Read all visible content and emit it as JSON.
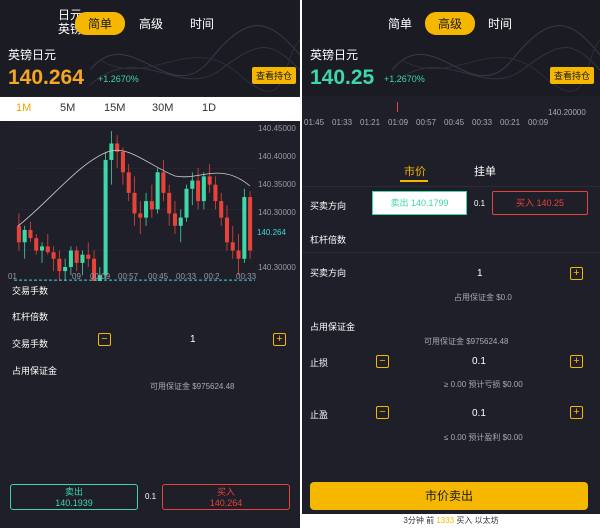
{
  "left": {
    "overlay_text_1": "日元",
    "overlay_text_2": "英镑",
    "tabs": [
      "简单",
      "高级",
      "时间"
    ],
    "active_tab": 0,
    "pair_name": "英镑日元",
    "price": "140.264",
    "change": "+1.2670%",
    "hold_button": "查看持仓",
    "timeframes": [
      "1M",
      "5M",
      "15M",
      "30M",
      "1D"
    ],
    "active_timeframe": 0,
    "y_ticks": [
      "140.45000",
      "140.40000",
      "140.35000",
      "140.30000",
      "140.264",
      "140.30000"
    ],
    "x_ticks": [
      "01",
      "09",
      "00:09",
      "00:57",
      "00:45",
      "00:33",
      "00:2",
      "00:33"
    ],
    "current_price_label": "140.264",
    "labels": {
      "trade_qty_1": "交易手数",
      "leverage": "杠杆倍数",
      "trade_qty_2": "交易手数",
      "margin": "占用保证金"
    },
    "qty_value": "1",
    "available_margin": "可用保证金 $975624.48",
    "sell_label": "卖出",
    "sell_price": "140.1939",
    "spread": "0.1",
    "buy_label": "买入",
    "buy_price": "140.264",
    "stepper_minus": "−",
    "stepper_plus": "+"
  },
  "right": {
    "tabs": [
      "简单",
      "高级",
      "时间"
    ],
    "active_tab": 1,
    "pair_name": "英镑日元",
    "price": "140.25",
    "change": "+1.2670%",
    "hold_button": "查看持仓",
    "axis_times": [
      "01:45",
      "01:33",
      "01:21",
      "01:09",
      "00:57",
      "00:45",
      "00:33",
      "00:21",
      "00:09"
    ],
    "axis_price": "140.20000",
    "order_tabs": [
      "市价",
      "挂单"
    ],
    "active_order_tab": 0,
    "direction_label": "买卖方向",
    "sell_btn": "卖出 140.1799",
    "spread": "0.1",
    "buy_btn": "买入 140.25",
    "leverage_label": "杠杆倍数",
    "direction_label_2": "买卖方向",
    "qty_value": "1",
    "margin_note_1": "占用保证金 $0.0",
    "margin_label": "占用保证金",
    "available_margin": "可用保证金 $975624.48",
    "stop_loss_label": "止损",
    "stop_loss_value": "0.1",
    "stop_loss_note": "≥ 0.00 预计亏损 $0.00",
    "take_profit_label": "止盈",
    "take_profit_value": "0.1",
    "take_profit_note": "≤ 0.00 预计盈利 $0.00",
    "submit_button": "市价卖出",
    "footer_prefix": "3分钟 前",
    "footer_highlight": "1333",
    "footer_suffix": "买入 以太坊",
    "stepper_minus": "−",
    "stepper_plus": "+"
  },
  "colors": {
    "accent": "#f5b700",
    "up": "#3fd6a8",
    "down": "#e8433b",
    "panel_bg": "#1f1f29"
  },
  "chart_data": {
    "type": "candlestick",
    "y_ticks": [
      "140.45000",
      "140.40000",
      "140.35000",
      "140.30000",
      "140.30000"
    ],
    "ylim": [
      140.28,
      140.45
    ],
    "current_price": 140.264,
    "x_ticks": [
      "01",
      "09",
      "00:09",
      "00:57",
      "00:45",
      "00:33",
      "00:2",
      "00:33"
    ],
    "series": [
      {
        "values": [
          [
            140.33,
            140.345,
            140.3,
            140.31
          ],
          [
            140.31,
            140.33,
            140.29,
            140.325
          ],
          [
            140.325,
            140.335,
            140.31,
            140.315
          ],
          [
            140.315,
            140.32,
            140.295,
            140.3
          ],
          [
            140.3,
            140.31,
            140.285,
            140.305
          ],
          [
            140.305,
            140.32,
            140.295,
            140.298
          ],
          [
            140.298,
            140.305,
            140.275,
            140.29
          ],
          [
            140.29,
            140.3,
            140.262,
            140.275
          ],
          [
            140.275,
            140.29,
            140.26,
            140.28
          ],
          [
            140.28,
            140.305,
            140.27,
            140.3
          ],
          [
            140.3,
            140.305,
            140.275,
            140.285
          ],
          [
            140.285,
            140.3,
            140.27,
            140.295
          ],
          [
            140.295,
            140.31,
            140.28,
            140.29
          ],
          [
            140.29,
            140.3,
            140.25,
            140.26
          ],
          [
            140.26,
            140.28,
            140.23,
            140.27
          ],
          [
            140.27,
            140.42,
            140.265,
            140.41
          ],
          [
            140.41,
            140.445,
            140.38,
            140.43
          ],
          [
            140.43,
            140.44,
            140.4,
            140.42
          ],
          [
            140.42,
            140.425,
            140.38,
            140.395
          ],
          [
            140.395,
            140.405,
            140.36,
            140.37
          ],
          [
            140.37,
            140.39,
            140.33,
            140.345
          ],
          [
            140.345,
            140.36,
            140.32,
            140.34
          ],
          [
            140.34,
            140.37,
            140.33,
            140.36
          ],
          [
            140.36,
            140.38,
            140.34,
            140.35
          ],
          [
            140.35,
            140.4,
            140.345,
            140.395
          ],
          [
            140.395,
            140.41,
            140.36,
            140.37
          ],
          [
            140.37,
            140.38,
            140.33,
            140.345
          ],
          [
            140.345,
            140.36,
            140.32,
            140.33
          ],
          [
            140.33,
            140.35,
            140.31,
            140.34
          ],
          [
            140.34,
            140.38,
            140.335,
            140.375
          ],
          [
            140.375,
            140.395,
            140.355,
            140.385
          ],
          [
            140.385,
            140.4,
            140.35,
            140.36
          ],
          [
            140.36,
            140.395,
            140.35,
            140.39
          ],
          [
            140.39,
            140.405,
            140.37,
            140.38
          ],
          [
            140.38,
            140.39,
            140.35,
            140.36
          ],
          [
            140.36,
            140.37,
            140.33,
            140.34
          ],
          [
            140.34,
            140.355,
            140.3,
            140.31
          ],
          [
            140.31,
            140.33,
            140.29,
            140.3
          ],
          [
            140.3,
            140.32,
            140.27,
            140.29
          ],
          [
            140.29,
            140.375,
            140.285,
            140.365
          ],
          [
            140.365,
            140.372,
            140.29,
            140.3
          ]
        ]
      }
    ],
    "candle_format": "open-high-low-close"
  }
}
